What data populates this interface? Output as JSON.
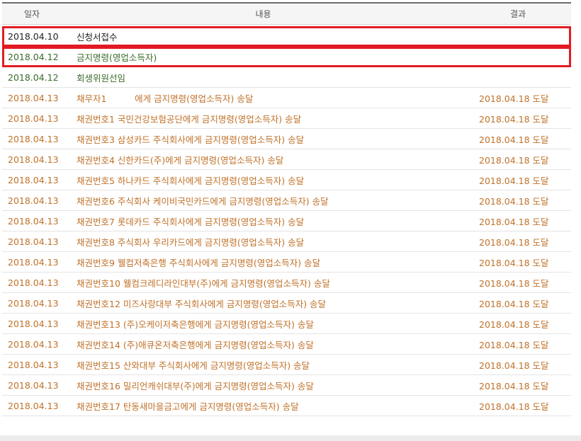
{
  "table": {
    "headers": {
      "date": "일자",
      "content": "내용",
      "result": "결과"
    },
    "rows": [
      {
        "date": "2018.04.10",
        "content": "신청서접수",
        "result": "",
        "color": "black",
        "highlight": true
      },
      {
        "date": "2018.04.12",
        "content": "금지명령(영업소득자)",
        "result": "",
        "color": "green",
        "highlight": true
      },
      {
        "date": "2018.04.12",
        "content": "회생위원선임",
        "result": "",
        "color": "green",
        "highlight": false
      },
      {
        "date": "2018.04.13",
        "content": "채무자1          에게 금지명령(영업소득자) 송달",
        "result": "2018.04.18 도달",
        "color": "orange",
        "highlight": false
      },
      {
        "date": "2018.04.13",
        "content": "채권번호1 국민건강보험공단에게 금지명령(영업소득자) 송달",
        "result": "2018.04.18 도달",
        "color": "orange",
        "highlight": false
      },
      {
        "date": "2018.04.13",
        "content": "채권번호3 삼성카드 주식회사에게 금지명령(영업소득자) 송달",
        "result": "2018.04.18 도달",
        "color": "orange",
        "highlight": false
      },
      {
        "date": "2018.04.13",
        "content": "채권번호4 신한카드(주)에게 금지명령(영업소득자) 송달",
        "result": "2018.04.18 도달",
        "color": "orange",
        "highlight": false
      },
      {
        "date": "2018.04.13",
        "content": "채권번호5 하나카드 주식회사에게 금지명령(영업소득자) 송달",
        "result": "2018.04.18 도달",
        "color": "orange",
        "highlight": false
      },
      {
        "date": "2018.04.13",
        "content": "채권번호6 주식회사 케이비국민카드에게 금지명령(영업소득자) 송달",
        "result": "2018.04.18 도달",
        "color": "orange",
        "highlight": false
      },
      {
        "date": "2018.04.13",
        "content": "채권번호7 롯데카드 주식회사에게 금지명령(영업소득자) 송달",
        "result": "2018.04.18 도달",
        "color": "orange",
        "highlight": false
      },
      {
        "date": "2018.04.13",
        "content": "채권번호8 주식회사 우리카드에게 금지명령(영업소득자) 송달",
        "result": "2018.04.18 도달",
        "color": "orange",
        "highlight": false
      },
      {
        "date": "2018.04.13",
        "content": "채권번호9 웰컴저축은행 주식회사에게 금지명령(영업소득자) 송달",
        "result": "2018.04.18 도달",
        "color": "orange",
        "highlight": false
      },
      {
        "date": "2018.04.13",
        "content": "채권번호10 웰컴크레디라인대부(주)에게 금지명령(영업소득자) 송달",
        "result": "2018.04.18 도달",
        "color": "orange",
        "highlight": false
      },
      {
        "date": "2018.04.13",
        "content": "채권번호12 미즈사랑대부 주식회사에게 금지명령(영업소득자) 송달",
        "result": "2018.04.18 도달",
        "color": "orange",
        "highlight": false
      },
      {
        "date": "2018.04.13",
        "content": "채권번호13 (주)오케이저축은행에게 금지명령(영업소득자) 송달",
        "result": "2018.04.18 도달",
        "color": "orange",
        "highlight": false
      },
      {
        "date": "2018.04.13",
        "content": "채권번호14 (주)애큐온저축은행에게 금지명령(영업소득자) 송달",
        "result": "2018.04.18 도달",
        "color": "orange",
        "highlight": false
      },
      {
        "date": "2018.04.13",
        "content": "채권번호15 산와대부 주식회사에게 금지명령(영업소득자) 송달",
        "result": "2018.04.18 도달",
        "color": "orange",
        "highlight": false
      },
      {
        "date": "2018.04.13",
        "content": "채권번호16 밀리언캐쉬대부(주)에게 금지명령(영업소득자) 송달",
        "result": "2018.04.18 도달",
        "color": "orange",
        "highlight": false
      },
      {
        "date": "2018.04.13",
        "content": "채권번호17 탄동새마을금고에게 금지명령(영업소득자) 송달",
        "result": "2018.04.18 도달",
        "color": "orange",
        "highlight": false
      }
    ]
  }
}
